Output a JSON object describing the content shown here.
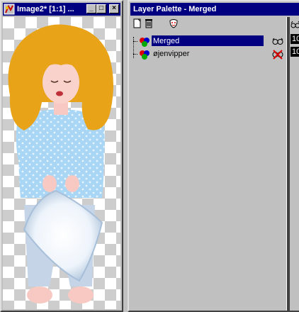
{
  "image_window": {
    "title": "Image2* [1:1] ...",
    "buttons": {
      "minimize": "_",
      "maximize": "□",
      "close": "×"
    }
  },
  "layer_palette": {
    "title": "Layer Palette - Merged",
    "layers": [
      {
        "name": "Merged",
        "selected": true,
        "visibility_icon": "glasses-icon"
      },
      {
        "name": "øjenvipper",
        "selected": false,
        "visibility_icon": "hidden-glasses-icon"
      }
    ],
    "opacity_values": [
      "10",
      "10"
    ]
  }
}
